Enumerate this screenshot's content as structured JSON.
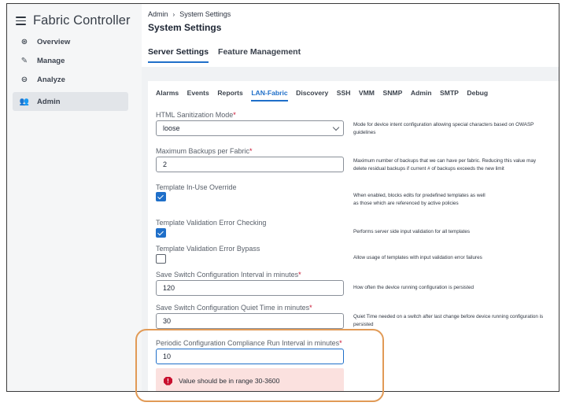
{
  "app": {
    "title": "Fabric Controller"
  },
  "sidebar": {
    "items": [
      {
        "label": "Overview",
        "icon": "overview-icon"
      },
      {
        "label": "Manage",
        "icon": "wrench-icon"
      },
      {
        "label": "Analyze",
        "icon": "analyze-icon"
      },
      {
        "label": "Admin",
        "icon": "admin-users-icon",
        "active": true
      }
    ]
  },
  "breadcrumb": {
    "root": "Admin",
    "separator": "›",
    "current": "System Settings"
  },
  "page": {
    "title": "System Settings"
  },
  "top_tabs": [
    {
      "label": "Server Settings",
      "active": true
    },
    {
      "label": "Feature Management",
      "active": false
    }
  ],
  "sub_tabs": [
    {
      "label": "Alarms"
    },
    {
      "label": "Events"
    },
    {
      "label": "Reports"
    },
    {
      "label": "LAN-Fabric",
      "active": true
    },
    {
      "label": "Discovery"
    },
    {
      "label": "SSH"
    },
    {
      "label": "VMM"
    },
    {
      "label": "SNMP"
    },
    {
      "label": "Admin"
    },
    {
      "label": "SMTP"
    },
    {
      "label": "Debug"
    }
  ],
  "fields": {
    "html_sanitization": {
      "label": "HTML Sanitization Mode",
      "required": "*",
      "value": "loose",
      "help": "Mode for device intent configuration allowing special characters based on OWASP guidelines"
    },
    "max_backups": {
      "label": "Maximum Backups per Fabric",
      "required": "*",
      "value": "2",
      "help": "Maximum number of backups that we can have per fabric. Reducing this value may delete residual backups if current # of backups exceeds the new limit"
    },
    "template_in_use_override": {
      "label": "Template In-Use Override",
      "checked": true,
      "help_line1": "When enabled, blocks edits for predefined templates as well",
      "help_line2": "as those which are referenced by active policies"
    },
    "template_validation_error_checking": {
      "label": "Template Validation Error Checking",
      "checked": true,
      "help": "Performs server side input validation for all templates"
    },
    "template_validation_error_bypass": {
      "label": "Template Validation Error Bypass",
      "checked": false,
      "help": "Allow usage of templates with input validation error failures"
    },
    "save_switch_interval": {
      "label": "Save Switch Configuration Interval in minutes",
      "required": "*",
      "value": "120",
      "help": "How often the device running configuration is persisted"
    },
    "save_switch_quiet_time": {
      "label": "Save Switch Configuration Quiet Time in minutes",
      "required": "*",
      "value": "30",
      "help": "Quiet Time needed on a switch after last change before device running configuration is persisted"
    },
    "compliance_interval": {
      "label": "Periodic Configuration Compliance Run Interval in minutes",
      "required": "*",
      "value": "10",
      "error": "Value should be in range 30-3600"
    }
  },
  "colors": {
    "accent": "#1f6fc9",
    "error": "#c8102e",
    "error_bg": "#fbe1df",
    "highlight": "#e19a56"
  }
}
